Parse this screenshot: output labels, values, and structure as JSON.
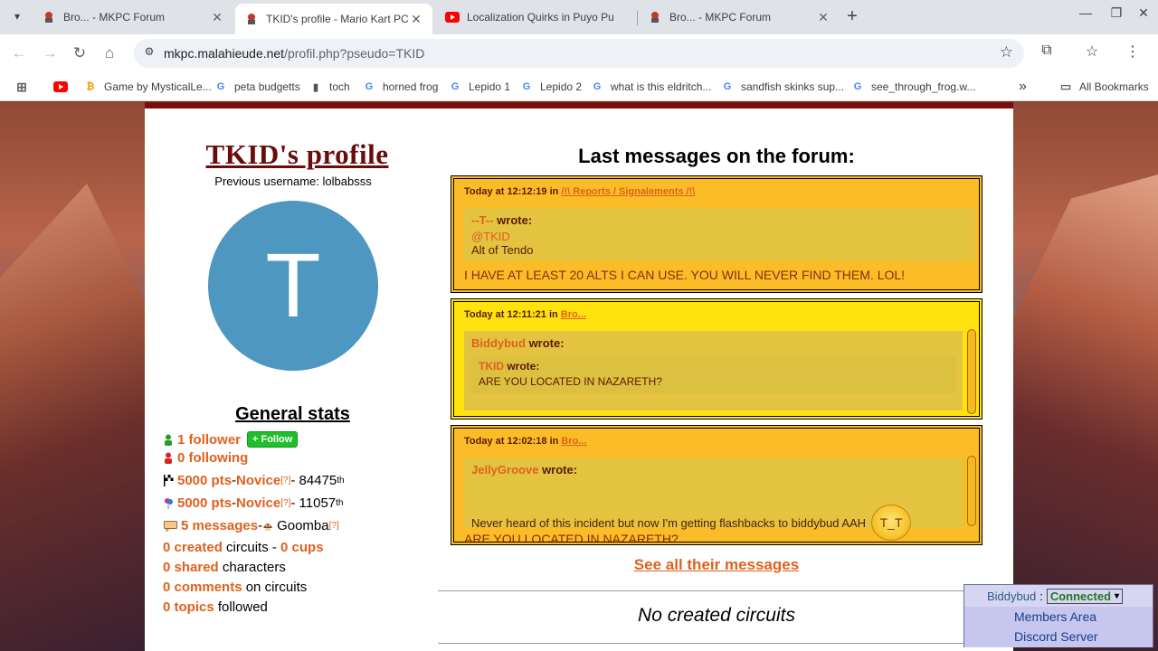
{
  "browser": {
    "tabs": [
      {
        "title": "Bro... - MKPC Forum",
        "favicon": "mario-kart-icon",
        "active": false
      },
      {
        "title": "TKID's profile - Mario Kart PC",
        "favicon": "mario-kart-icon",
        "active": true
      },
      {
        "title": "Localization Quirks in Puyo Pu",
        "favicon": "youtube-icon",
        "active": false
      },
      {
        "title": "Bro... - MKPC Forum",
        "favicon": "mario-kart-icon",
        "active": false
      }
    ],
    "new_tab": "+",
    "url_host": "mkpc.malahieude.net",
    "url_path": "/profil.php?pseudo=TKID",
    "bookmarks": [
      {
        "label": "",
        "icon": "youtube-icon"
      },
      {
        "label": "Game by MysticalLe...",
        "icon": "flame-icon"
      },
      {
        "label": "peta budgetts",
        "icon": "google-icon"
      },
      {
        "label": "toch",
        "icon": "can-icon"
      },
      {
        "label": "horned frog",
        "icon": "google-icon"
      },
      {
        "label": "Lepido 1",
        "icon": "google-icon"
      },
      {
        "label": "Lepido 2",
        "icon": "google-icon"
      },
      {
        "label": "what is this eldritch...",
        "icon": "google-icon"
      },
      {
        "label": "sandfish skinks sup...",
        "icon": "google-icon"
      },
      {
        "label": "see_through_frog.w...",
        "icon": "google-icon"
      }
    ],
    "all_bookmarks": "All Bookmarks",
    "overflow": "»"
  },
  "profile": {
    "title": "TKID's profile",
    "previous_username": "Previous username: lolbabsss",
    "avatar_letter": "T",
    "avatar_color": "#4d97c0",
    "general_stats_title": "General stats",
    "followers": "1 follower",
    "follow_button": "+ Follow",
    "following": "0 following",
    "pts1_value": "5000 pts",
    "pts1_rank": "Novice",
    "pts1_help": "[?]",
    "pts1_position": " - 84475",
    "pts1_suffix": "th",
    "pts2_value": "5000 pts",
    "pts2_rank": "Novice",
    "pts2_help": "[?]",
    "pts2_position": " - 11057",
    "pts2_suffix": "th",
    "messages": "5 messages",
    "messages_rank": "Goomba",
    "messages_help": "[?]",
    "created": "0 created",
    "created_label": " circuits - ",
    "cups": "0 cups",
    "shared": "0 shared",
    "shared_label": " characters",
    "comments": "0 comments",
    "comments_label": " on circuits",
    "topics": "0 topics",
    "topics_label": " followed",
    "dash": " - "
  },
  "messages_section": {
    "title": "Last messages on the forum:",
    "in_label": "in",
    "wrote_label": "wrote:",
    "items": [
      {
        "time": "Today at 12:12:19",
        "forum": "/!\\ Reports / Signalements /!\\",
        "quote_user": "--T--",
        "quote_lines": [
          "@TKID",
          "Alt of Tendo"
        ],
        "body": "I HAVE AT LEAST 20 ALTS I CAN USE. YOU WILL NEVER FIND THEM. LOL!"
      },
      {
        "time": "Today at 12:11:21",
        "forum": "Bro...",
        "quote_user": "Biddybud",
        "nested_user": "TKID",
        "nested_line": "ARE YOU LOCATED IN NAZARETH?"
      },
      {
        "time": "Today at 12:02:18",
        "forum": "Bro...",
        "quote_user": "JellyGroove",
        "quote_line": "Never heard of this incident but now I'm getting flashbacks to biddybud AAH",
        "emoji": "crying-face-emoji",
        "body_partial": "ARE YOU LOCATED IN NAZARETH?"
      }
    ],
    "see_all": "See all their messages",
    "no_circuits": "No created circuits"
  },
  "member_box": {
    "username": "Biddybud",
    "colon": ":",
    "status": "Connected",
    "links": [
      "Members Area",
      "Discord Server"
    ]
  },
  "colors": {
    "accent_orange": "#e0611d",
    "message_bg": "#fbbd27",
    "title_red": "#6b0c0c",
    "follow_green": "#1fbf2a"
  }
}
